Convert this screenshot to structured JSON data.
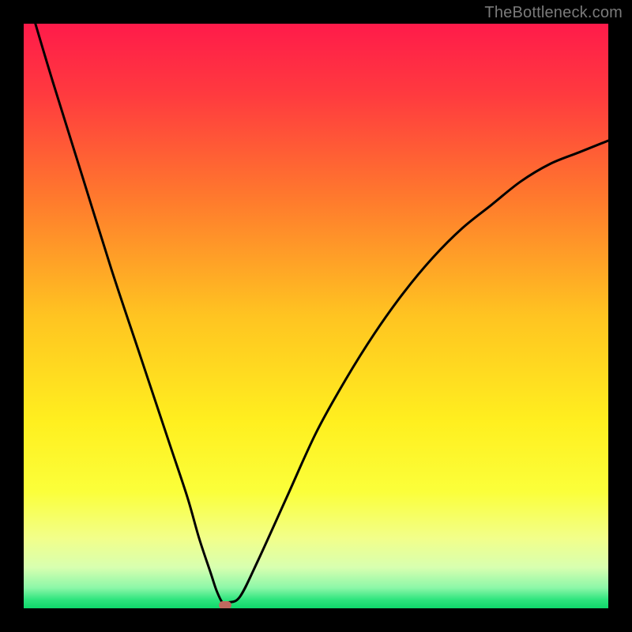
{
  "watermark": "TheBottleneck.com",
  "chart_data": {
    "type": "line",
    "title": "",
    "xlabel": "",
    "ylabel": "",
    "xlim": [
      0,
      100
    ],
    "ylim": [
      0,
      100
    ],
    "series": [
      {
        "name": "bottleneck-curve",
        "x": [
          2,
          5,
          10,
          15,
          20,
          25,
          28,
          30,
          32,
          33,
          34,
          35,
          37,
          40,
          45,
          50,
          55,
          60,
          65,
          70,
          75,
          80,
          85,
          90,
          95,
          100
        ],
        "values": [
          100,
          90,
          74,
          58,
          43,
          28,
          19,
          12,
          6,
          3,
          1,
          1,
          2,
          8,
          19,
          30,
          39,
          47,
          54,
          60,
          65,
          69,
          73,
          76,
          78,
          80
        ]
      }
    ],
    "marker": {
      "x": 34.5,
      "y": 0.5,
      "color": "#c0695f"
    },
    "gradient_stops": [
      {
        "offset": 0.0,
        "color": "#ff1b4a"
      },
      {
        "offset": 0.12,
        "color": "#ff3a3f"
      },
      {
        "offset": 0.3,
        "color": "#ff7a2d"
      },
      {
        "offset": 0.5,
        "color": "#ffc421"
      },
      {
        "offset": 0.68,
        "color": "#ffef1f"
      },
      {
        "offset": 0.8,
        "color": "#fbff3a"
      },
      {
        "offset": 0.88,
        "color": "#f2ff8a"
      },
      {
        "offset": 0.93,
        "color": "#d8ffb0"
      },
      {
        "offset": 0.965,
        "color": "#8cf7a8"
      },
      {
        "offset": 0.985,
        "color": "#2fe57e"
      },
      {
        "offset": 1.0,
        "color": "#0fd86b"
      }
    ]
  }
}
